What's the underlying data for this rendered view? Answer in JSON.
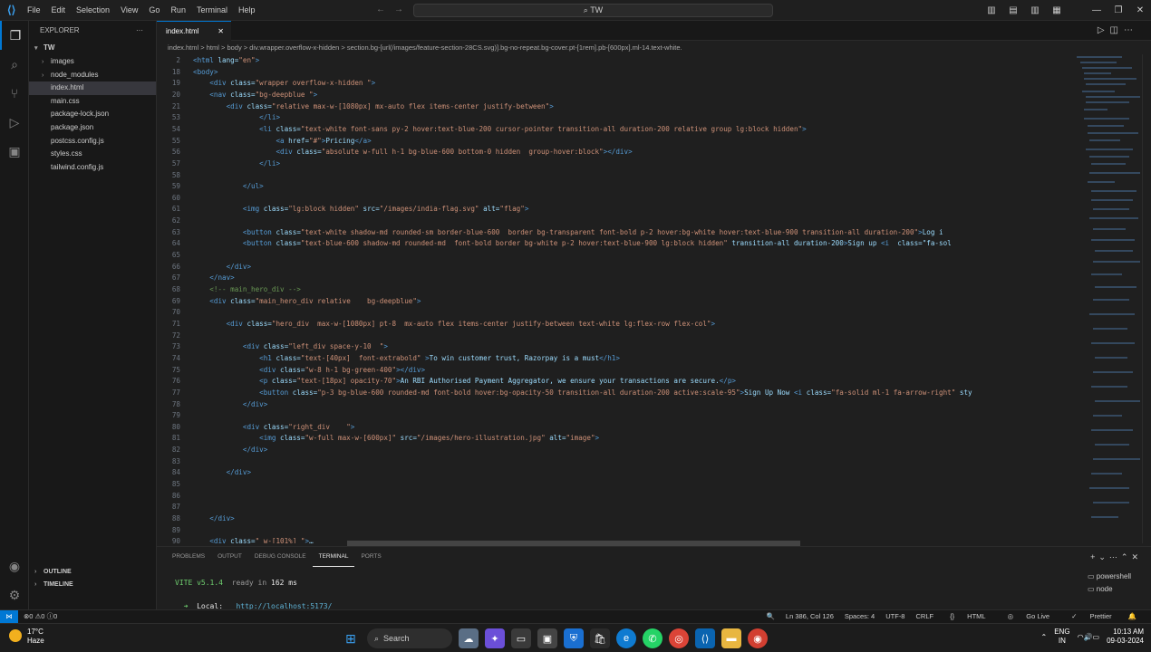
{
  "titlebar": {
    "menu": [
      "File",
      "Edit",
      "Selection",
      "View",
      "Go",
      "Run",
      "Terminal",
      "Help"
    ],
    "search": "TW"
  },
  "sidebar": {
    "header": "EXPLORER",
    "root": "TW",
    "items": [
      {
        "label": "images",
        "folder": true
      },
      {
        "label": "node_modules",
        "folder": true
      },
      {
        "label": "index.html",
        "selected": true
      },
      {
        "label": "main.css"
      },
      {
        "label": "package-lock.json"
      },
      {
        "label": "package.json"
      },
      {
        "label": "postcss.config.js"
      },
      {
        "label": "styles.css"
      },
      {
        "label": "tailwind.config.js"
      }
    ],
    "outline": "OUTLINE",
    "timeline": "TIMELINE"
  },
  "editor": {
    "tab": "index.html",
    "breadcrumb": "index.html > html > body > div.wrapper.overflow-x-hidden > section.bg-[url(/images/feature-section-28CS.svg)].bg-no-repeat.bg-cover.pt-[1rem].pb-[600px].ml-14.text-white.",
    "lines": [
      {
        "n": "2",
        "t": "<html lang=\"en\">"
      },
      {
        "n": "18",
        "t": "<body>"
      },
      {
        "n": "19",
        "t": "    <div class=\"wrapper overflow-x-hidden \">"
      },
      {
        "n": "20",
        "t": "    <nav class=\"bg-deepblue \">"
      },
      {
        "n": "21",
        "t": "        <div class=\"relative max-w-[1080px] mx-auto flex items-center justify-between\">"
      },
      {
        "n": "53",
        "t": "                </li>"
      },
      {
        "n": "54",
        "t": "                <li class=\"text-white font-sans py-2 hover:text-blue-200 cursor-pointer transition-all duration-200 relative group lg:block hidden\">"
      },
      {
        "n": "55",
        "t": "                    <a href=\"#\">Pricing</a>"
      },
      {
        "n": "56",
        "t": "                    <div class=\"absolute w-full h-1 bg-blue-600 bottom-0 hidden  group-hover:block\"></div>"
      },
      {
        "n": "57",
        "t": "                </li>"
      },
      {
        "n": "58",
        "t": ""
      },
      {
        "n": "59",
        "t": "            </ul>"
      },
      {
        "n": "60",
        "t": ""
      },
      {
        "n": "61",
        "t": "            <img class=\"lg:block hidden\" src=\"/images/india-flag.svg\" alt=\"flag\">"
      },
      {
        "n": "62",
        "t": ""
      },
      {
        "n": "63",
        "t": "            <button class=\"text-white shadow-md rounded-sm border-blue-600  border bg-transparent font-bold p-2 hover:bg-white hover:text-blue-900 transition-all duration-200\">Log i"
      },
      {
        "n": "64",
        "t": "            <button class=\"text-blue-600 shadow-md rounded-md  font-bold border bg-white p-2 hover:text-blue-900 lg:block hidden\" transition-all duration-200>Sign up <i  class=\"fa-sol"
      },
      {
        "n": "65",
        "t": ""
      },
      {
        "n": "66",
        "t": "        </div>"
      },
      {
        "n": "67",
        "t": "    </nav>"
      },
      {
        "n": "68",
        "t": "    <!-- main_hero_div -->"
      },
      {
        "n": "69",
        "t": "    <div class=\"main_hero_div relative    bg-deepblue\">"
      },
      {
        "n": "70",
        "t": ""
      },
      {
        "n": "71",
        "t": "        <div class=\"hero_div  max-w-[1080px] pt-8  mx-auto flex items-center justify-between text-white lg:flex-row flex-col\">"
      },
      {
        "n": "72",
        "t": ""
      },
      {
        "n": "73",
        "t": "            <div class=\"left_div space-y-10  \">"
      },
      {
        "n": "74",
        "t": "                <h1 class=\"text-[40px]  font-extrabold\" >To win customer trust, Razorpay is a must</h1>"
      },
      {
        "n": "75",
        "t": "                <div class=\"w-8 h-1 bg-green-400\"></div>"
      },
      {
        "n": "76",
        "t": "                <p class=\"text-[18px] opacity-70\">An RBI Authorised Payment Aggregator, we ensure your transactions are secure.</p>"
      },
      {
        "n": "77",
        "t": "                <button class=\"p-3 bg-blue-600 rounded-md font-bold hover:bg-opacity-50 transition-all duration-200 active:scale-95\">Sign Up Now <i class=\"fa-solid ml-1 fa-arrow-right\" sty"
      },
      {
        "n": "78",
        "t": "            </div>"
      },
      {
        "n": "79",
        "t": ""
      },
      {
        "n": "80",
        "t": "            <div class=\"right_div    \">"
      },
      {
        "n": "81",
        "t": "                <img class=\"w-full max-w-[600px]\" src=\"/images/hero-illustration.jpg\" alt=\"image\">"
      },
      {
        "n": "82",
        "t": "            </div>"
      },
      {
        "n": "83",
        "t": ""
      },
      {
        "n": "84",
        "t": "        </div>"
      },
      {
        "n": "85",
        "t": ""
      },
      {
        "n": "86",
        "t": ""
      },
      {
        "n": "87",
        "t": ""
      },
      {
        "n": "88",
        "t": "    </div>"
      },
      {
        "n": "89",
        "t": ""
      },
      {
        "n": "90",
        "t": "    <div class=\" w-[101%] \">…"
      }
    ]
  },
  "panel": {
    "tabs": [
      "PROBLEMS",
      "OUTPUT",
      "DEBUG CONSOLE",
      "TERMINAL",
      "PORTS"
    ],
    "active_tab": "TERMINAL",
    "terminal": {
      "vite": "VITE",
      "version": "v5.1.4",
      "ready": "ready in",
      "time": "162 ms",
      "local_label": "Local:",
      "local_url": "http://localhost:5173/"
    },
    "terminals": [
      "powershell",
      "node"
    ]
  },
  "statusbar": {
    "errors": "0",
    "warnings": "0",
    "info": "0",
    "position": "Ln 386, Col 126",
    "spaces": "Spaces: 4",
    "encoding": "UTF-8",
    "eol": "CRLF",
    "language": "HTML",
    "golive": "Go Live",
    "prettier": "Prettier"
  },
  "taskbar": {
    "temp": "17°C",
    "weather": "Haze",
    "search": "Search",
    "lang1": "ENG",
    "lang2": "IN",
    "time": "10:13 AM",
    "date": "09-03-2024"
  }
}
